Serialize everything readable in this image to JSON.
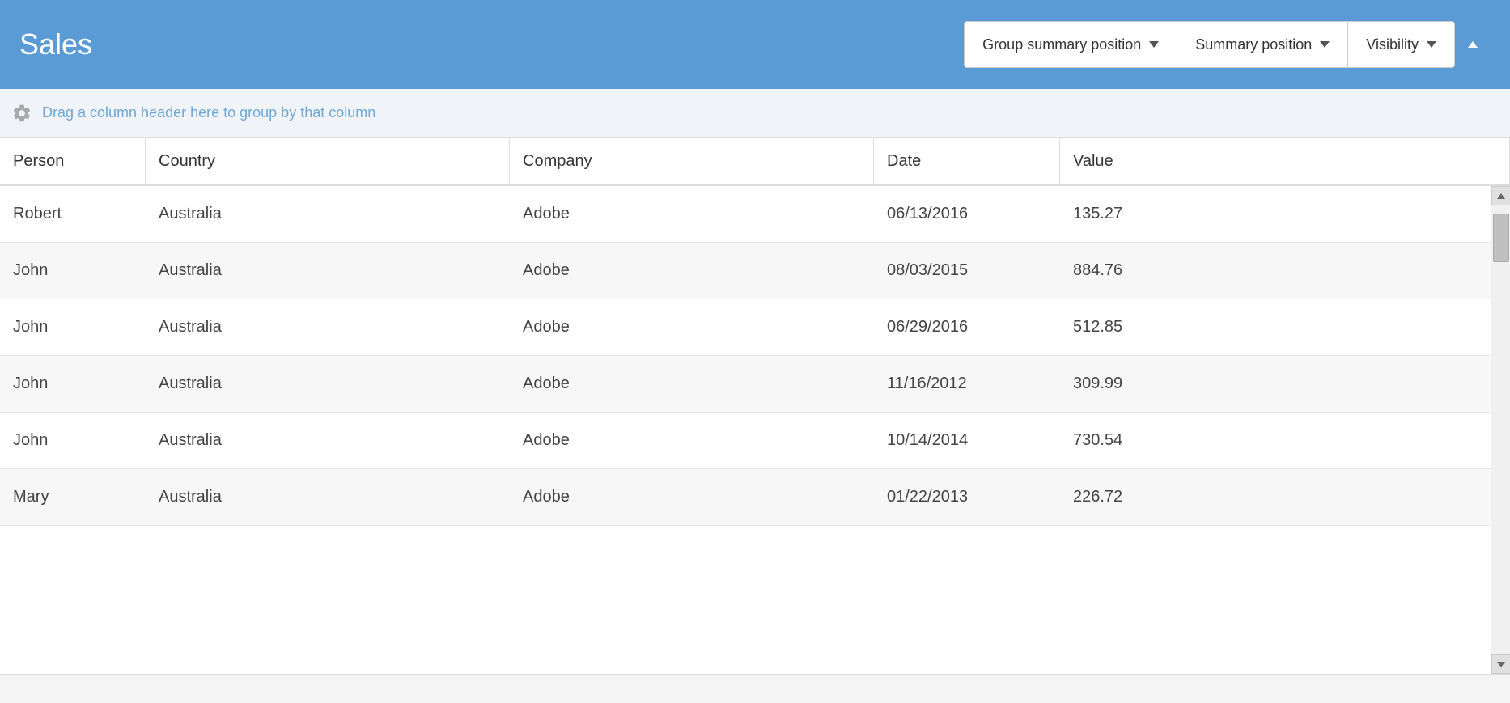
{
  "header": {
    "title": "Sales",
    "controls": {
      "group_summary_label": "Group summary position",
      "summary_label": "Summary position",
      "visibility_label": "Visibility"
    }
  },
  "group_bar": {
    "placeholder": "Drag a column header here to group by that column"
  },
  "columns": [
    {
      "key": "person",
      "label": "Person"
    },
    {
      "key": "country",
      "label": "Country"
    },
    {
      "key": "company",
      "label": "Company"
    },
    {
      "key": "date",
      "label": "Date"
    },
    {
      "key": "value",
      "label": "Value"
    }
  ],
  "rows": [
    {
      "person": "Robert",
      "country": "Australia",
      "company": "Adobe",
      "date": "06/13/2016",
      "value": "135.27"
    },
    {
      "person": "John",
      "country": "Australia",
      "company": "Adobe",
      "date": "08/03/2015",
      "value": "884.76"
    },
    {
      "person": "John",
      "country": "Australia",
      "company": "Adobe",
      "date": "06/29/2016",
      "value": "512.85"
    },
    {
      "person": "John",
      "country": "Australia",
      "company": "Adobe",
      "date": "11/16/2012",
      "value": "309.99"
    },
    {
      "person": "John",
      "country": "Australia",
      "company": "Adobe",
      "date": "10/14/2014",
      "value": "730.54"
    },
    {
      "person": "Mary",
      "country": "Australia",
      "company": "Adobe",
      "date": "01/22/2013",
      "value": "226.72"
    }
  ],
  "colors": {
    "header_bg": "#5b9bd5",
    "header_text": "#ffffff",
    "row_odd": "#ffffff",
    "row_even": "#f7f7f7"
  }
}
